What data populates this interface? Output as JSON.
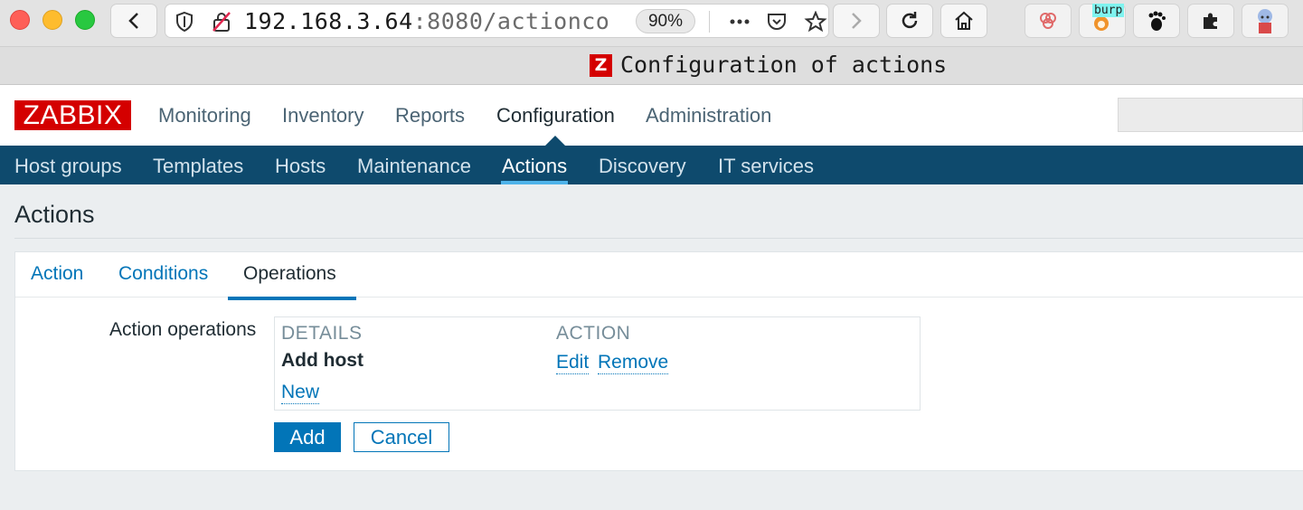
{
  "browser": {
    "url_host": "192.168.3.64",
    "url_rest": ":8080/actionco",
    "zoom": "90%",
    "burp_label": "burp",
    "tab_favicon_letter": "Z",
    "tab_title": "Configuration of actions"
  },
  "zabbix": {
    "logo": "ZABBIX",
    "top_menu": [
      "Monitoring",
      "Inventory",
      "Reports",
      "Configuration",
      "Administration"
    ],
    "top_menu_selected": "Configuration",
    "sub_menu": [
      "Host groups",
      "Templates",
      "Hosts",
      "Maintenance",
      "Actions",
      "Discovery",
      "IT services"
    ],
    "sub_menu_selected": "Actions"
  },
  "page": {
    "title": "Actions",
    "tabs": [
      "Action",
      "Conditions",
      "Operations"
    ],
    "tab_selected": "Operations"
  },
  "form": {
    "label": "Action operations",
    "columns": {
      "details": "DETAILS",
      "action": "ACTION"
    },
    "operations": [
      {
        "details": "Add host",
        "edit": "Edit",
        "remove": "Remove"
      }
    ],
    "new_link": "New",
    "add_button": "Add",
    "cancel_button": "Cancel"
  },
  "colors": {
    "brand_red": "#d40000",
    "subnav_bg": "#0e4a6d",
    "link_blue": "#0275b8"
  }
}
